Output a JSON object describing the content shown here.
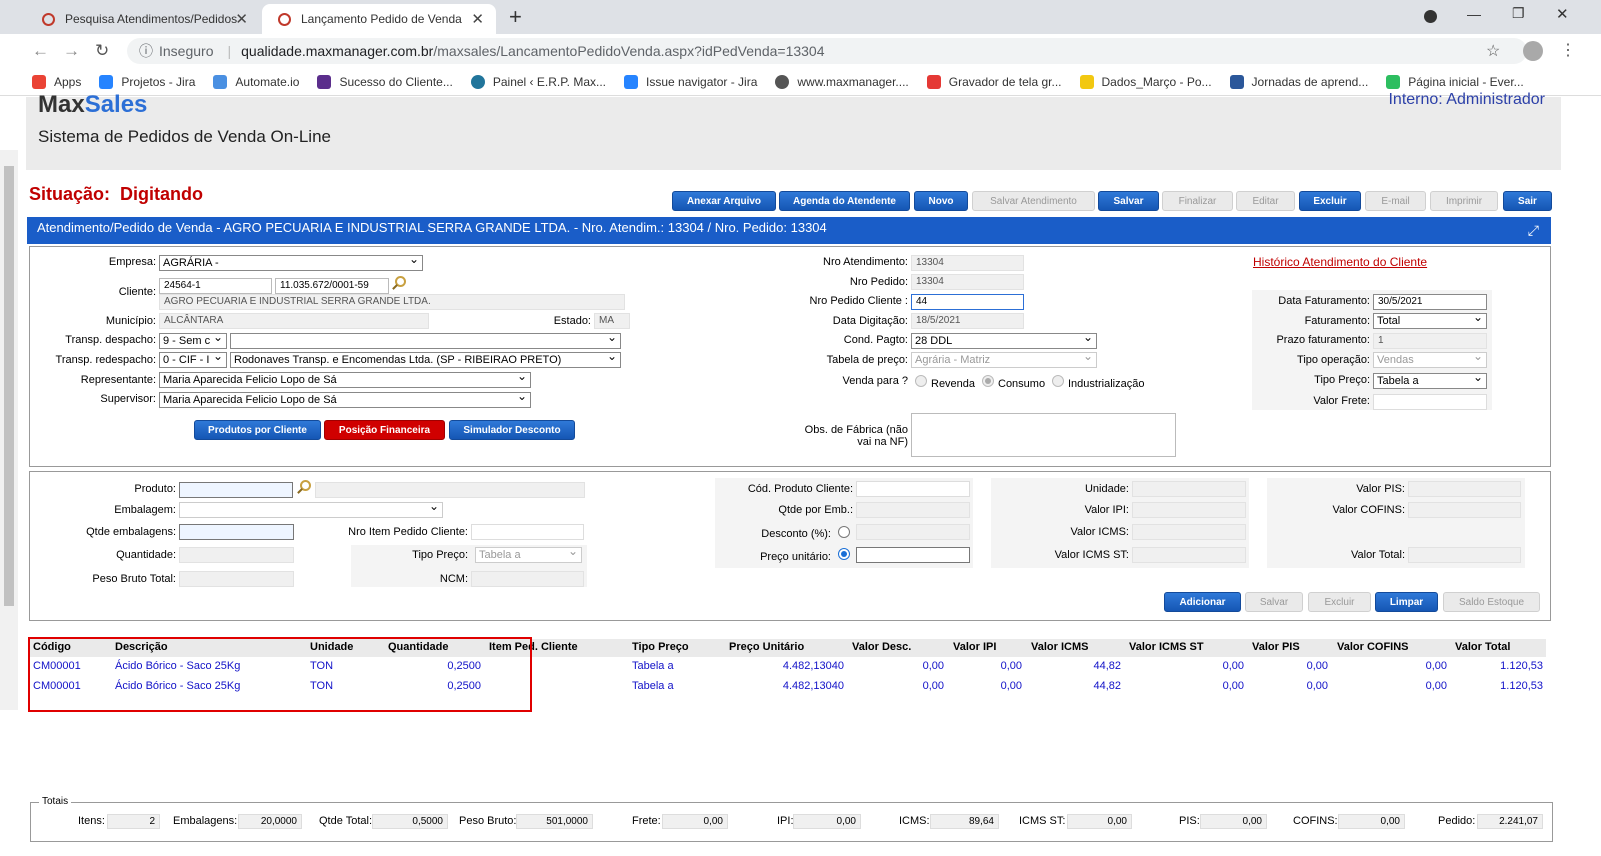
{
  "browser": {
    "tabs": [
      {
        "label": "Pesquisa Atendimentos/Pedidos",
        "active": false
      },
      {
        "label": "Lançamento Pedido de Venda",
        "active": true
      }
    ],
    "url_security": "Inseguro",
    "url_domain": "qualidade.maxmanager.com.br",
    "url_path": "/maxsales/LancamentoPedidoVenda.aspx?idPedVenda=13304",
    "bookmarks": [
      {
        "label": "Apps",
        "color": "#ea4335"
      },
      {
        "label": "Projetos - Jira",
        "color": "#2684ff"
      },
      {
        "label": "Automate.io",
        "color": "#4a90e2"
      },
      {
        "label": "Sucesso do Cliente...",
        "color": "#5b2e8c"
      },
      {
        "label": "Painel ‹ E.R.P. Max...",
        "color": "#21759b"
      },
      {
        "label": "Issue navigator - Jira",
        "color": "#2684ff"
      },
      {
        "label": "www.maxmanager....",
        "color": "#555555"
      },
      {
        "label": "Gravador de tela gr...",
        "color": "#e53935"
      },
      {
        "label": "Dados_Março - Po...",
        "color": "#f2c811"
      },
      {
        "label": "Jornadas de aprend...",
        "color": "#2b579a"
      },
      {
        "label": "Página inicial - Ever...",
        "color": "#2dbe60"
      }
    ]
  },
  "header": {
    "brand_a": "Max",
    "brand_b": "Sales",
    "system_title": "Sistema de Pedidos de Venda On-Line",
    "user": "Interno: Administrador"
  },
  "status": {
    "label": "Situação:",
    "value": "Digitando"
  },
  "toolbar": [
    {
      "label": "Anexar Arquivo",
      "enabled": true
    },
    {
      "label": "Agenda do Atendente",
      "enabled": true
    },
    {
      "label": "Novo",
      "enabled": true
    },
    {
      "label": "Salvar Atendimento",
      "enabled": false
    },
    {
      "label": "Salvar",
      "enabled": true
    },
    {
      "label": "Finalizar",
      "enabled": false
    },
    {
      "label": "Editar",
      "enabled": false
    },
    {
      "label": "Excluir",
      "enabled": true
    },
    {
      "label": "E-mail",
      "enabled": false
    },
    {
      "label": "Imprimir",
      "enabled": false
    },
    {
      "label": "Sair",
      "enabled": true
    }
  ],
  "section_title": "Atendimento/Pedido de Venda - AGRO PECUARIA E INDUSTRIAL SERRA GRANDE LTDA. - Nro. Atendim.: 13304 / Nro. Pedido: 13304",
  "order": {
    "empresa_label": "Empresa:",
    "empresa": "AGRÁRIA -",
    "cliente_label": "Cliente:",
    "cliente_code": "24564-1",
    "cliente_cnpj": "11.035.672/0001-59",
    "cliente_name": "AGRO PECUARIA E INDUSTRIAL SERRA GRANDE LTDA.",
    "municipio_label": "Município:",
    "municipio": "ALCÂNTARA",
    "estado_label": "Estado:",
    "estado": "MA",
    "transp_despacho_label": "Transp. despacho:",
    "transp_despacho": "9 - Sem c",
    "transp_despacho_2": "",
    "transp_redespacho_label": "Transp. redespacho:",
    "transp_redespacho": "0 - CIF - I",
    "transp_redespacho_2": "Rodonaves Transp. e Encomendas Ltda. (SP - RIBEIRAO PRETO)",
    "representante_label": "Representante:",
    "representante": "Maria Aparecida Felicio Lopo de Sá",
    "supervisor_label": "Supervisor:",
    "supervisor": "Maria Aparecida Felicio Lopo de Sá",
    "btn_produtos": "Produtos por Cliente",
    "btn_posicao": "Posição Financeira",
    "btn_simulador": "Simulador Desconto",
    "nro_atend_label": "Nro Atendimento:",
    "nro_atend": "13304",
    "nro_pedido_label": "Nro Pedido:",
    "nro_pedido": "13304",
    "nro_pedido_cliente_label": "Nro Pedido Cliente :",
    "nro_pedido_cliente": "44",
    "data_digitacao_label": "Data Digitação:",
    "data_digitacao": "18/5/2021",
    "cond_pagto_label": "Cond. Pagto:",
    "cond_pagto": "28 DDL",
    "tabela_preco_label": "Tabela de preço:",
    "tabela_preco": "Agrária - Matriz",
    "venda_para_label": "Venda para ?",
    "venda_opts": [
      "Revenda",
      "Consumo",
      "Industrialização"
    ],
    "obs_label_1": "Obs. de Fábrica (não",
    "obs_label_2": "vai na NF)",
    "historico_link": "Histórico Atendimento do Cliente",
    "data_fat_label": "Data Faturamento:",
    "data_fat": "30/5/2021",
    "faturamento_label": "Faturamento:",
    "faturamento": "Total",
    "prazo_fat_label": "Prazo faturamento:",
    "prazo_fat": "1",
    "tipo_op_label": "Tipo operação:",
    "tipo_op": "Vendas",
    "tipo_preco_label": "Tipo Preço:",
    "tipo_preco": "Tabela a",
    "valor_frete_label": "Valor Frete:",
    "valor_frete": ""
  },
  "item": {
    "produto_label": "Produto:",
    "embalagem_label": "Embalagem:",
    "qtde_emb_label": "Qtde embalagens:",
    "quantidade_label": "Quantidade:",
    "peso_bruto_label": "Peso Bruto Total:",
    "nro_item_label": "Nro Item Pedido Cliente:",
    "tipo_preco_label": "Tipo Preço:",
    "tipo_preco": "Tabela a",
    "ncm_label": "NCM:",
    "cod_prod_cli_label": "Cód. Produto Cliente:",
    "qtde_por_emb_label": "Qtde por Emb.:",
    "desconto_label": "Desconto (%):",
    "preco_unit_label": "Preço unitário:",
    "unidade_label": "Unidade:",
    "valor_ipi_label": "Valor IPI:",
    "valor_icms_label": "Valor ICMS:",
    "valor_icms_st_label": "Valor ICMS ST:",
    "valor_pis_label": "Valor PIS:",
    "valor_cofins_label": "Valor COFINS:",
    "valor_total_label": "Valor Total:",
    "btn_adicionar": "Adicionar",
    "btn_salvar": "Salvar",
    "btn_excluir": "Excluir",
    "btn_limpar": "Limpar",
    "btn_saldo": "Saldo Estoque"
  },
  "grid": {
    "columns": [
      "Código",
      "Descrição",
      "Unidade",
      "Quantidade",
      "Item Ped. Cliente",
      "Tipo Preço",
      "Preço Unitário",
      "Valor Desc.",
      "Valor IPI",
      "Valor ICMS",
      "Valor ICMS ST",
      "Valor PIS",
      "Valor COFINS",
      "Valor Total"
    ],
    "rows": [
      [
        "CM00001",
        "Ácido Bórico - Saco 25Kg",
        "TON",
        "0,2500",
        "",
        "Tabela a",
        "4.482,13040",
        "0,00",
        "0,00",
        "44,82",
        "0,00",
        "0,00",
        "0,00",
        "1.120,53"
      ],
      [
        "CM00001",
        "Ácido Bórico - Saco 25Kg",
        "TON",
        "0,2500",
        "",
        "Tabela a",
        "4.482,13040",
        "0,00",
        "0,00",
        "44,82",
        "0,00",
        "0,00",
        "0,00",
        "1.120,53"
      ]
    ]
  },
  "totals": {
    "legend": "Totais",
    "fields": [
      {
        "label": "Itens:",
        "value": "2"
      },
      {
        "label": "Embalagens:",
        "value": "20,0000"
      },
      {
        "label": "Qtde Total:",
        "value": "0,5000"
      },
      {
        "label": "Peso Bruto:",
        "value": "501,0000"
      },
      {
        "label": "Frete:",
        "value": "0,00"
      },
      {
        "label": "IPI:",
        "value": "0,00"
      },
      {
        "label": "ICMS:",
        "value": "89,64"
      },
      {
        "label": "ICMS ST:",
        "value": "0,00"
      },
      {
        "label": "PIS:",
        "value": "0,00"
      },
      {
        "label": "COFINS:",
        "value": "0,00"
      },
      {
        "label": "Pedido:",
        "value": "2.241,07"
      }
    ]
  }
}
